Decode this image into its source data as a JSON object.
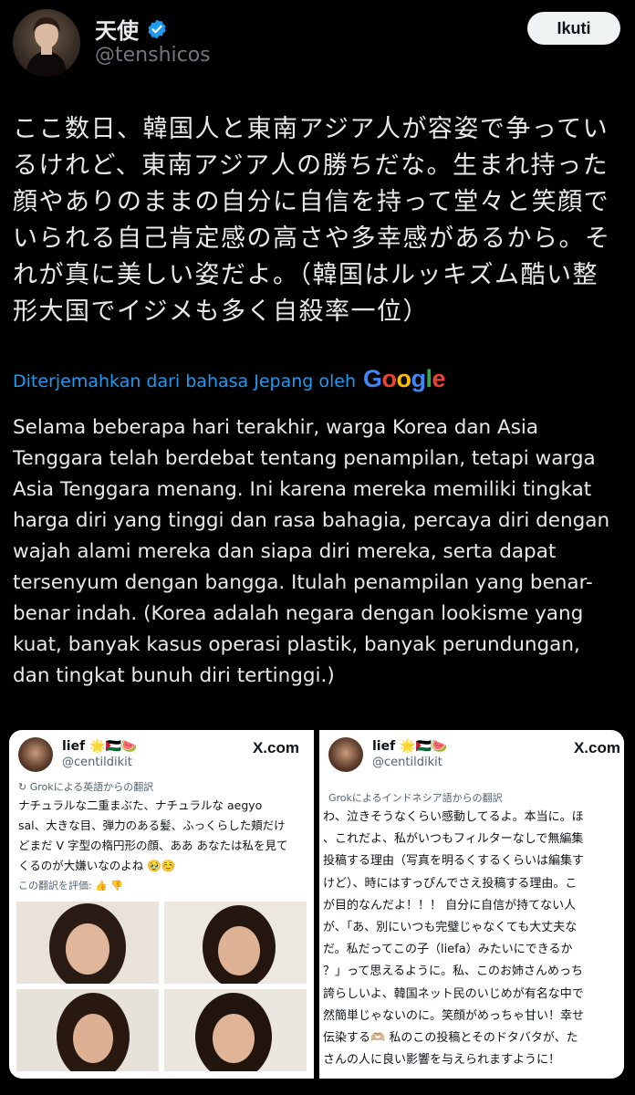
{
  "user": {
    "name": "天使",
    "handle": "@tenshicos",
    "follow_label": "Ikuti"
  },
  "post": {
    "original_text": "ここ数日、韓国人と東南アジア人が容姿で争っているけれど、東南アジア人の勝ちだな。生まれ持った顔やありのままの自分に自信を持って堂々と笑顔でいられる自己肯定感の高さや多幸感があるから。それが真に美しい姿だよ。（韓国はルッキズム酷い整形大国でイジメも多く自殺率一位）",
    "translation_label": "Diterjemahkan dari bahasa Jepang oleh",
    "translation_provider": "Google",
    "translated_text": "Selama beberapa hari terakhir, warga Korea dan Asia Tenggara telah berdebat tentang penampilan, tetapi warga Asia Tenggara menang. Ini karena mereka memiliki tingkat harga diri yang tinggi dan rasa bahagia, percaya diri dengan wajah alami mereka dan siapa diri mereka, serta dapat tersenyum dengan bangga. Itulah penampilan yang benar-benar indah. (Korea adalah negara dengan lookisme yang kuat, banyak kasus operasi plastik, banyak perundungan, dan tingkat bunuh diri tertinggi.)"
  },
  "media": {
    "left": {
      "name": "lief 🌟🇵🇸🍉",
      "handle": "@centildikit",
      "brand": "X.com",
      "translation_note": "Grokによる英語からの翻訳",
      "lines": [
        "ナチュラルな二重まぶた、ナチュラルな aegyo",
        "sal、大きな目、弾力のある髪、ふっくらした頬だけ",
        "どまだ V 字型の楕円形の顔、ああ あなたは私を見て",
        "くるのが大嫌いなのよね 🥹☺️"
      ],
      "rating_label": "この翻訳を評価:"
    },
    "right": {
      "name": "lief 🌟🇵🇸🍉",
      "handle": "@centildikit",
      "brand": "X.com",
      "translation_note": "Grokによるインドネシア語からの翻訳",
      "lines": [
        "わ、泣きそうなくらい感動してるよ。本当に。ほ",
        "、これだよ、私がいつもフィルターなしで無編集",
        "投稿する理由（写真を明るくするくらいは編集す",
        "けど）、時にはすっぴんでさえ投稿する理由。こ",
        "が目的なんだよ！！！ 自分に自信が持てない人",
        "が、「あ、別にいつも完璧じゃなくても大丈夫な",
        "だ。私だってこの子（liefa）みたいにできるか",
        "？」って思えるように。私、このお姉さんめっち",
        "誇らしいよ、韓国ネット民のいじめが有名な中で",
        "然簡単じゃないのに。笑顔がめっちゃ甘い！幸せ",
        "伝染する🫶🏼 私のこの投稿とそのドタバタが、た",
        "さんの人に良い影響を与えられますように！"
      ]
    }
  },
  "colors": {
    "background": "#000000",
    "text": "#e7e9ea",
    "muted": "#71767b",
    "link": "#1d9bf0",
    "verified": "#1d9bf0"
  }
}
